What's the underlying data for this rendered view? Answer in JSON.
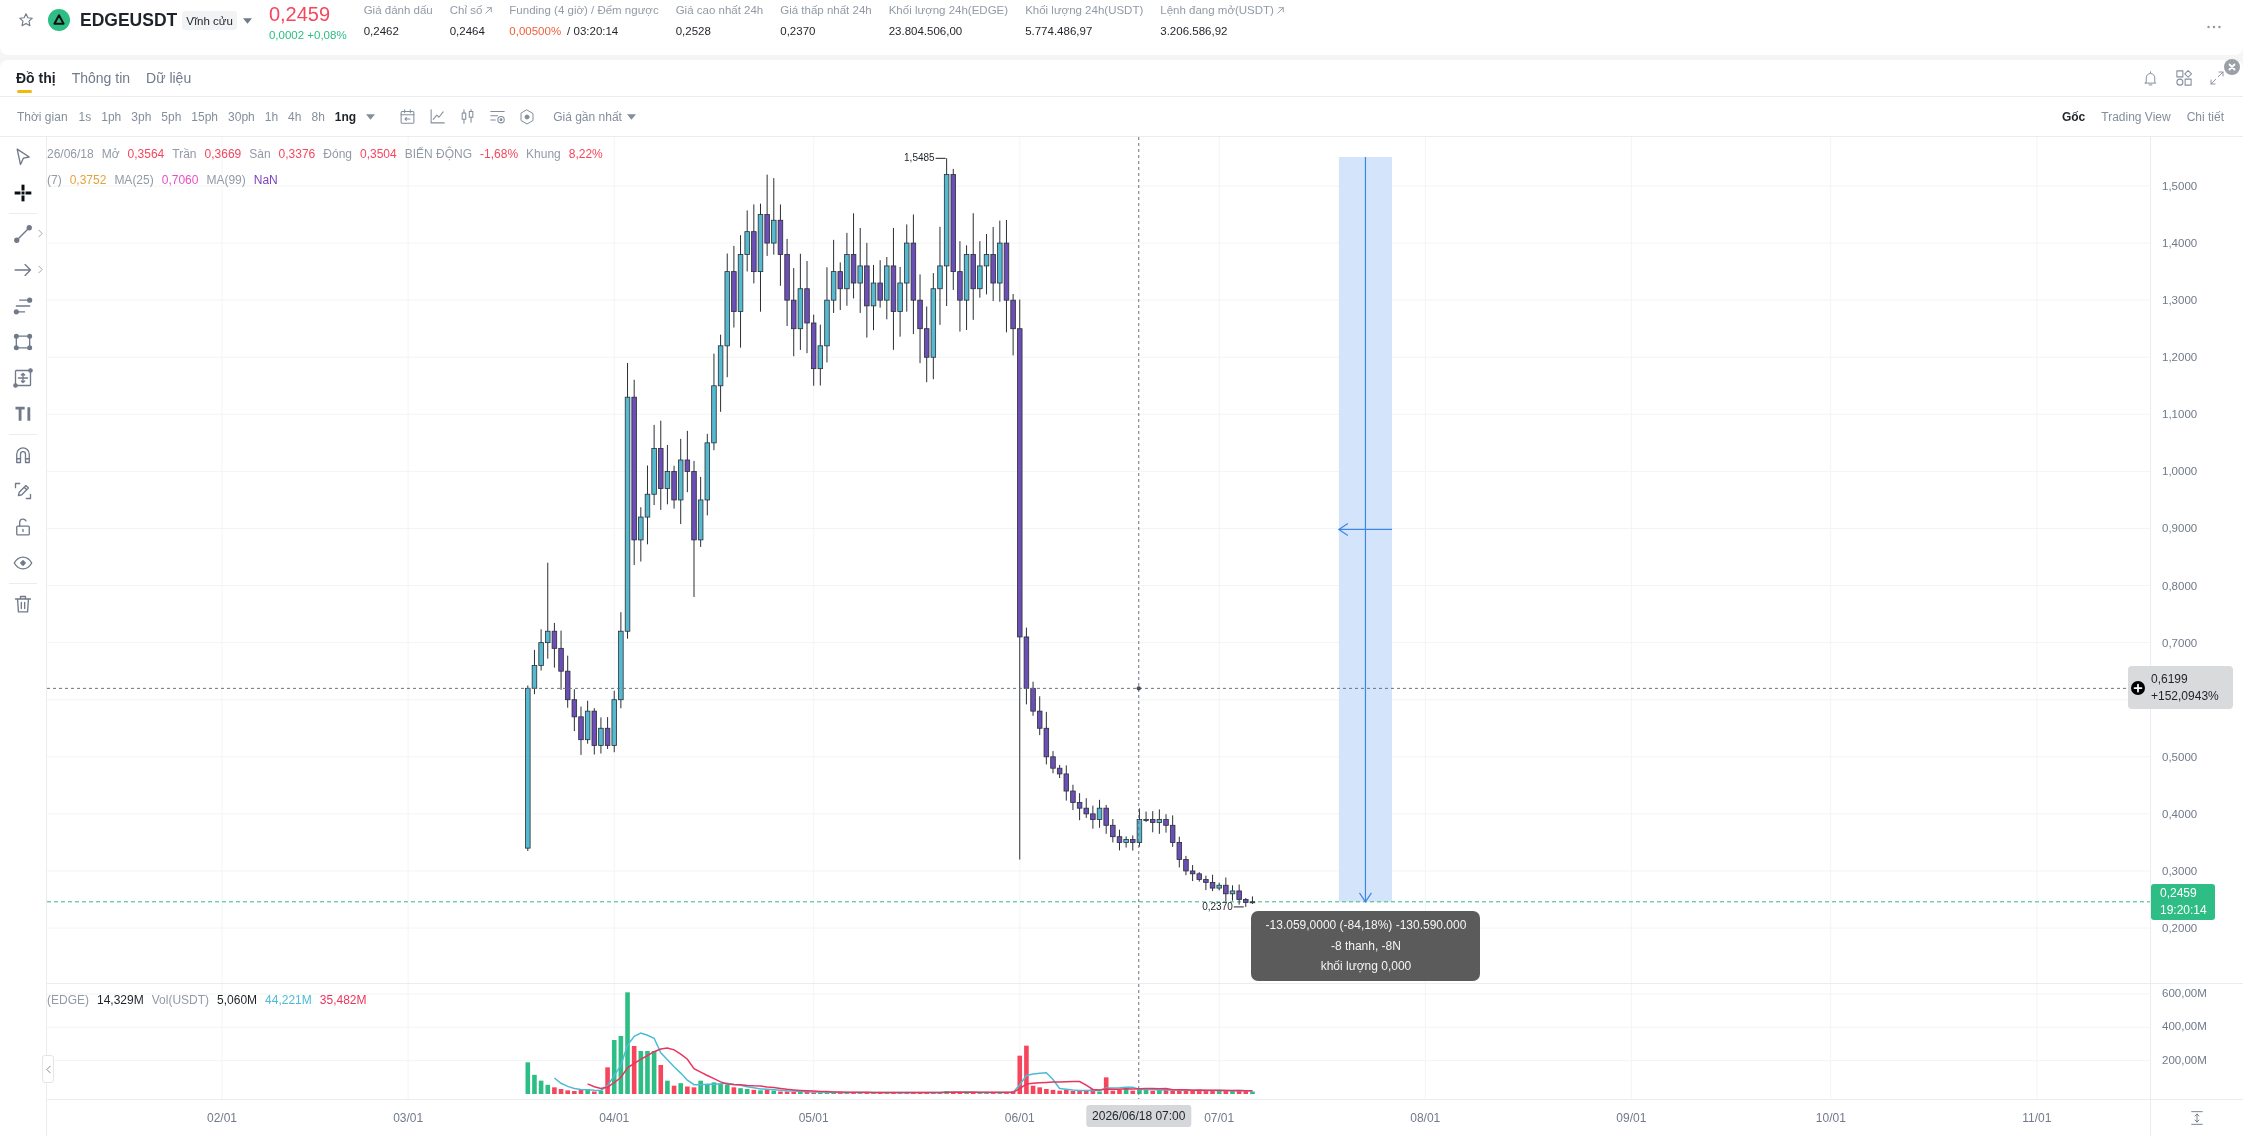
{
  "header": {
    "pair": "EDGEUSDT",
    "contract": "Vĩnh cửu",
    "price": "0,2459",
    "change": "0,0002 +0,08%",
    "stats": [
      {
        "label": "Giá đánh dấu",
        "value": "0,2462",
        "link": false,
        "kind": "plain"
      },
      {
        "label": "Chỉ số",
        "value": "0,2464",
        "link": true,
        "kind": "plain"
      },
      {
        "label": "Funding (4 giờ) / Đếm ngược",
        "value": "0,00500%",
        "countdown": "/ 03:20:14",
        "link": false,
        "kind": "funding"
      },
      {
        "label": "Giá cao nhất 24h",
        "value": "0,2528",
        "link": false,
        "kind": "plain"
      },
      {
        "label": "Giá thấp nhất 24h",
        "value": "0,2370",
        "link": false,
        "kind": "plain"
      },
      {
        "label": "Khối lượng 24h(EDGE)",
        "value": "23.804.506,00",
        "link": false,
        "kind": "plain"
      },
      {
        "label": "Khối lượng 24h(USDT)",
        "value": "5.774.486,97",
        "link": false,
        "kind": "plain"
      },
      {
        "label": "Lệnh đang mở(USDT)",
        "value": "3.206.586,92",
        "link": true,
        "kind": "plain"
      }
    ]
  },
  "tabs": [
    {
      "label": "Đồ thị",
      "selected": true
    },
    {
      "label": "Thông tin",
      "selected": false
    },
    {
      "label": "Dữ liệu",
      "selected": false
    }
  ],
  "interval_label": "Thời gian",
  "intervals": [
    {
      "label": "1s",
      "selected": false
    },
    {
      "label": "1ph",
      "selected": false
    },
    {
      "label": "3ph",
      "selected": false
    },
    {
      "label": "5ph",
      "selected": false
    },
    {
      "label": "15ph",
      "selected": false
    },
    {
      "label": "30ph",
      "selected": false
    },
    {
      "label": "1h",
      "selected": false
    },
    {
      "label": "4h",
      "selected": false
    },
    {
      "label": "8h",
      "selected": false
    },
    {
      "label": "1ng",
      "selected": true
    }
  ],
  "price_source": "Giá gần nhất",
  "chart_views": [
    {
      "label": "Gốc",
      "selected": true
    },
    {
      "label": "Trading View",
      "selected": false
    },
    {
      "label": "Chi tiết",
      "selected": false
    }
  ],
  "tool_groups": [
    {
      "tools": [
        {
          "kind": "cursor",
          "selected": false,
          "submenu": false
        },
        {
          "kind": "crosshair",
          "selected": true,
          "submenu": false
        }
      ]
    },
    {
      "tools": [
        {
          "kind": "line",
          "selected": false,
          "submenu": true
        },
        {
          "kind": "arrow",
          "selected": false,
          "submenu": true
        },
        {
          "kind": "parallel",
          "selected": false,
          "submenu": false
        },
        {
          "kind": "rectangle",
          "selected": false,
          "submenu": false
        },
        {
          "kind": "measure",
          "selected": false,
          "submenu": false
        },
        {
          "kind": "text",
          "selected": false,
          "submenu": false
        }
      ]
    },
    {
      "tools": [
        {
          "kind": "magnet",
          "selected": false,
          "submenu": false
        },
        {
          "kind": "pencil",
          "selected": false,
          "submenu": false
        },
        {
          "kind": "lock",
          "selected": false,
          "submenu": false
        },
        {
          "kind": "eye",
          "selected": false,
          "submenu": false
        }
      ]
    },
    {
      "tools": [
        {
          "kind": "trash",
          "selected": false,
          "submenu": false
        }
      ]
    }
  ],
  "legend": {
    "date": "26/06/18",
    "fields": [
      {
        "label": "Mở",
        "value": "0,3564"
      },
      {
        "label": "Trần",
        "value": "0,3669"
      },
      {
        "label": "Sàn",
        "value": "0,3376"
      },
      {
        "label": "Đóng",
        "value": "0,3504"
      },
      {
        "label": "BIẾN ĐỘNG",
        "value": "-1,68%"
      },
      {
        "label": "Khung",
        "value": "8,22%"
      }
    ]
  },
  "moving_averages": [
    {
      "label": "(7)",
      "value": "0,3752",
      "color": "#e3a33b"
    },
    {
      "label": "MA(25)",
      "value": "0,7060",
      "color": "#e94fc4"
    },
    {
      "label": "MA(99)",
      "value": "NaN",
      "color": "#7b3fbe"
    }
  ],
  "price_axis": {
    "ticks": [
      "1,5000",
      "1,4000",
      "1,3000",
      "1,2000",
      "1,1000",
      "1,0000",
      "0,9000",
      "0,8000",
      "0,7000",
      "0,5000",
      "0,4000",
      "0,3000",
      "0,2000"
    ]
  },
  "high_label": "1,5485",
  "low_label": "0,2370",
  "crosshair": {
    "price": "0,6199",
    "change": "+152,0943%",
    "time": "2026/06/18 07:00"
  },
  "last_price": {
    "price": "0,2459",
    "countdown": "19:20:14"
  },
  "measure": {
    "lines": [
      "-13.059,0000 (-84,18%) -130.590.000",
      "-8 thanh, -8N",
      "khối lượng 0,000"
    ]
  },
  "volume_legend": [
    {
      "label": "(EDGE)",
      "value": "14,329M",
      "color": "#1e2329"
    },
    {
      "label": "Vol(USDT)",
      "value": "5,060M",
      "color": "#1e2329"
    },
    {
      "value": "44,221M",
      "color": "#4cbcd6"
    },
    {
      "value": "35,482M",
      "color": "#e9355d"
    }
  ],
  "volume_axis": {
    "ticks": [
      "600,00M",
      "400,00M",
      "200,00M"
    ]
  },
  "time_axis": {
    "ticks": [
      "02/01",
      "03/01",
      "04/01",
      "05/01",
      "06/01",
      "07/01",
      "08/01",
      "09/01",
      "10/01",
      "11/01"
    ]
  }
}
